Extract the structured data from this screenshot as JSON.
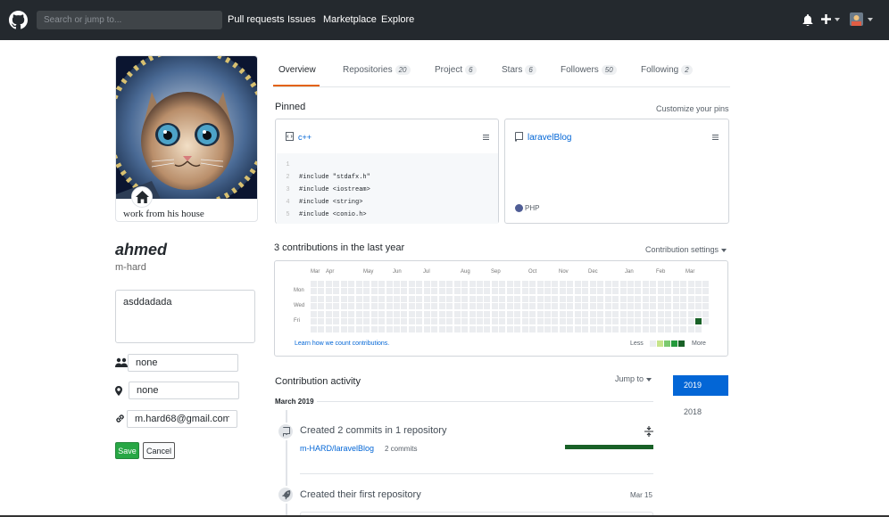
{
  "header": {
    "search_placeholder": "Search or jump to...",
    "nav": [
      "Pull requests",
      "Issues",
      "Marketplace",
      "Explore"
    ]
  },
  "profile": {
    "status_text": "work from his house",
    "name": "ahmed",
    "login": "m-hard",
    "bio": "asddadada",
    "company": "none",
    "location": "none",
    "email": "m.hard68@gmail.com",
    "save_label": "Save",
    "cancel_label": "Cancel"
  },
  "tabs": [
    {
      "label": "Overview",
      "count": ""
    },
    {
      "label": "Repositories",
      "count": "20"
    },
    {
      "label": "Project",
      "count": "6"
    },
    {
      "label": "Stars",
      "count": "6"
    },
    {
      "label": "Followers",
      "count": "50"
    },
    {
      "label": "Following",
      "count": "2"
    }
  ],
  "pinned": {
    "title": "Pinned",
    "customize": "Customize your pins",
    "cards": [
      {
        "name": "c++",
        "code": [
          {
            "n": "1",
            "t": ""
          },
          {
            "n": "2",
            "t": "#include \"stdafx.h\""
          },
          {
            "n": "3",
            "t": "#include <iostream>"
          },
          {
            "n": "4",
            "t": "#include <string>"
          },
          {
            "n": "5",
            "t": "#include <conio.h>"
          }
        ]
      },
      {
        "name": "laravelBlog",
        "language": "PHP",
        "language_color": "#4f5d95"
      }
    ]
  },
  "contributions": {
    "title": "3 contributions in the last year",
    "settings": "Contribution settings",
    "months": [
      "Mar",
      "Apr",
      "May",
      "Jun",
      "Jul",
      "Aug",
      "Sep",
      "Oct",
      "Nov",
      "Dec",
      "Jan",
      "Feb",
      "Mar"
    ],
    "days": [
      "Mon",
      "Wed",
      "Fri"
    ],
    "learn": "Learn how we count contributions.",
    "less": "Less",
    "more": "More",
    "colors": [
      "#ebedf0",
      "#c6e48b",
      "#7bc96f",
      "#239a3b",
      "#196127"
    ]
  },
  "activity": {
    "title": "Contribution activity",
    "jump": "Jump to",
    "month": "March 2019",
    "years": [
      "2019",
      "2018"
    ],
    "items": [
      {
        "text": "Created 2 commits in 1 repository",
        "repo": "m-HARD/laravelBlog",
        "count": "2 commits",
        "progress": 1.0
      },
      {
        "text": "Created their first repository",
        "date": "Mar 15"
      }
    ]
  }
}
